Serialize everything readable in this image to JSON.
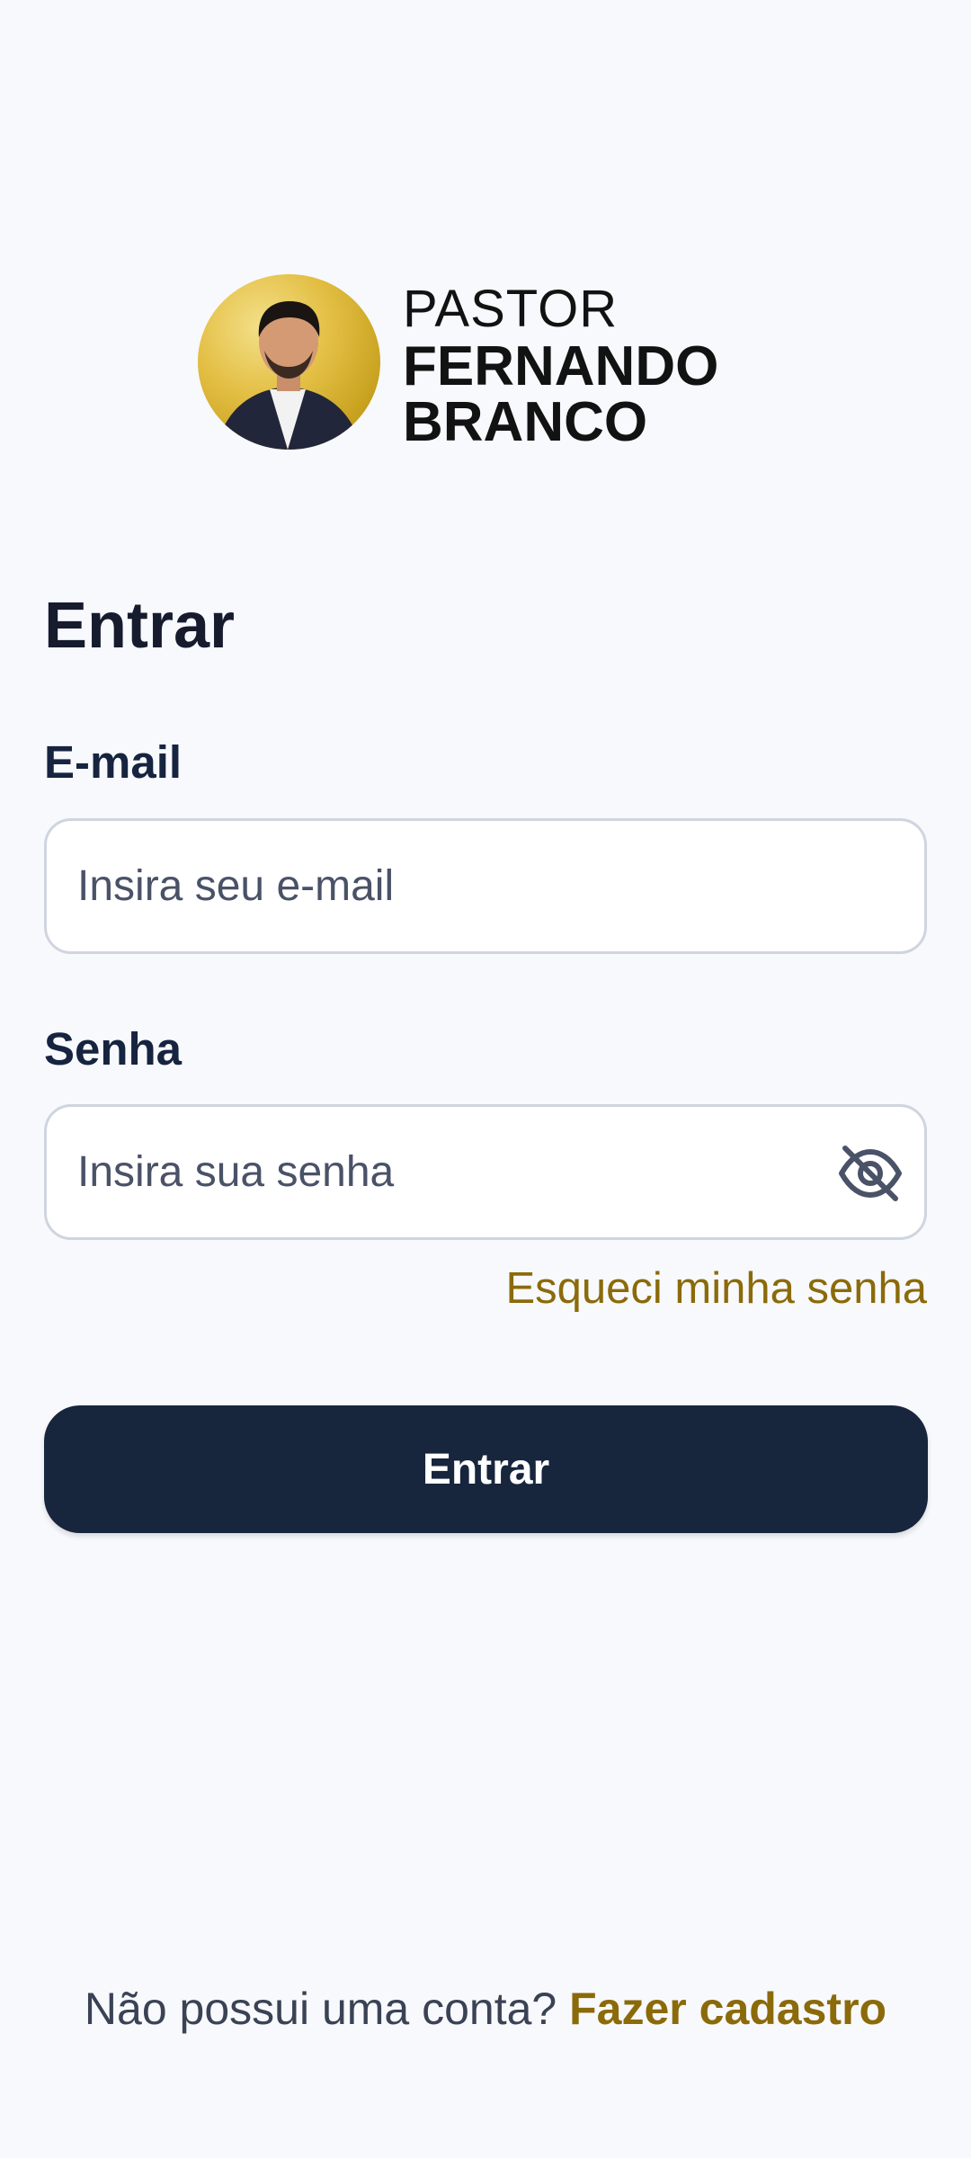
{
  "brand": {
    "line1": "PASTOR",
    "line2": "FERNANDO",
    "line3": "BRANCO"
  },
  "login": {
    "title": "Entrar",
    "email": {
      "label": "E-mail",
      "placeholder": "Insira seu e-mail",
      "value": ""
    },
    "password": {
      "label": "Senha",
      "placeholder": "Insira sua senha",
      "value": "",
      "visibility_icon": "eye-off-icon"
    },
    "forgot_password": "Esqueci minha senha",
    "submit_label": "Entrar"
  },
  "footer": {
    "prompt": "Não possui uma conta?",
    "signup_link": "Fazer cadastro"
  },
  "colors": {
    "background": "#f8f9fc",
    "primary": "#17253d",
    "accent": "#8b6a0a",
    "avatar_gold": "#e3bf45"
  }
}
